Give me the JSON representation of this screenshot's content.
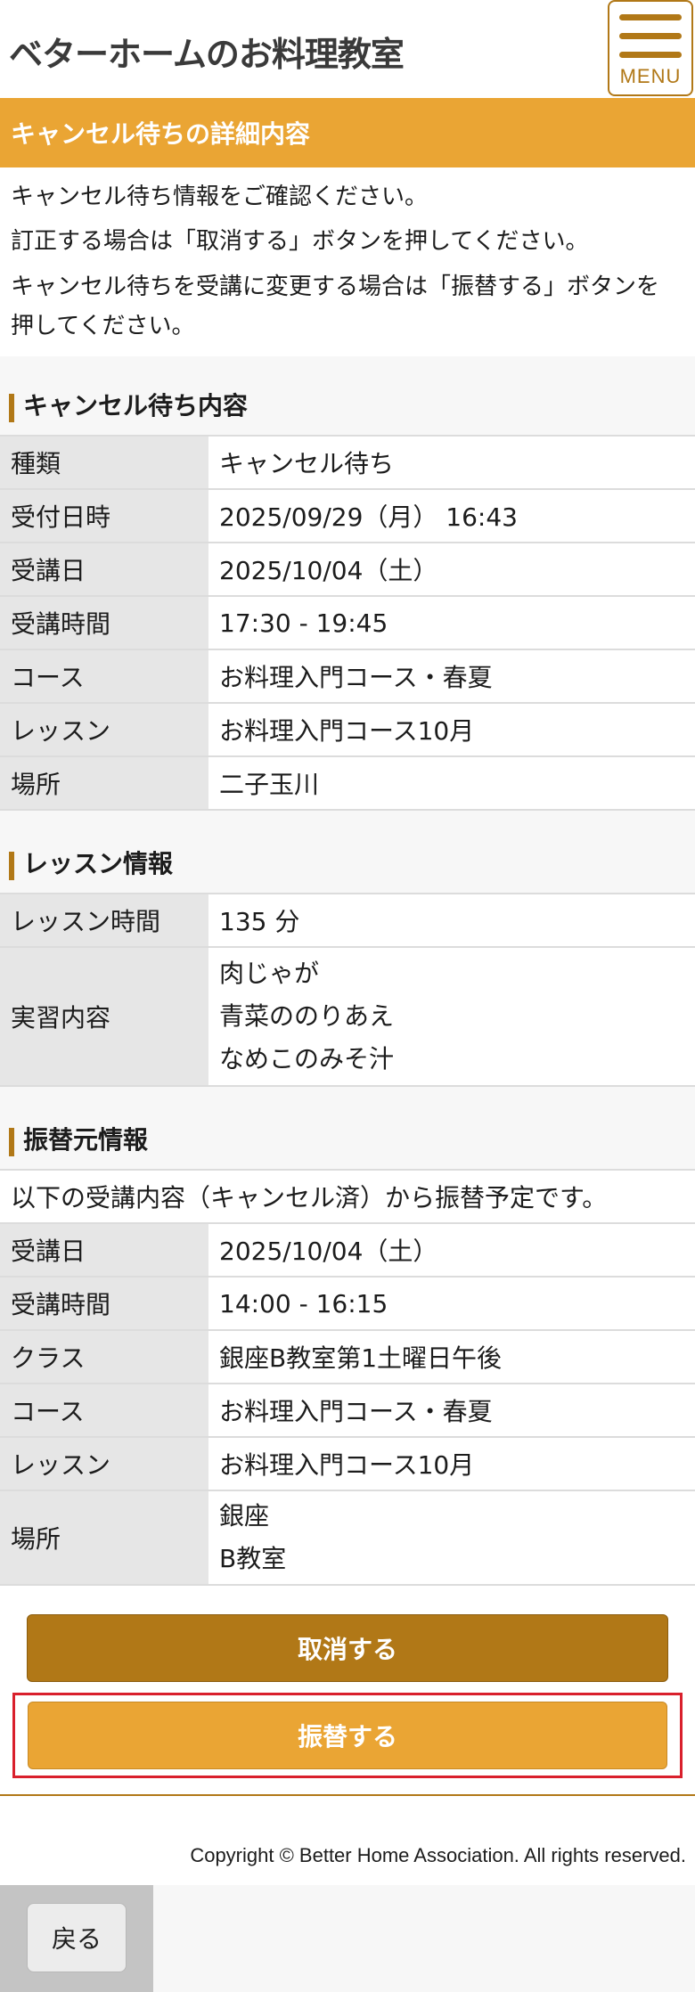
{
  "header": {
    "logo_text": "ベターホームのお料理教室",
    "menu_label": "MENU",
    "accent_color": "#b17817"
  },
  "title_bar": {
    "title": "キャンセル待ちの詳細内容",
    "color": "#eaa534"
  },
  "intro": {
    "line1": "キャンセル待ち情報をご確認ください。",
    "line2": "訂正する場合は「取消する」ボタンを押してください。",
    "line3a": "キャンセル待ちを受講に変更する場合は「振替する」ボタンを",
    "line3b": "押してください。"
  },
  "section_waitlist": {
    "heading": "キャンセル待ち内容",
    "rows": [
      {
        "label": "種類",
        "value": "キャンセル待ち"
      },
      {
        "label": "受付日時",
        "value": "2025/09/29（月） 16:43"
      },
      {
        "label": "受講日",
        "value": "2025/10/04（土）"
      },
      {
        "label": "受講時間",
        "value": "17:30 - 19:45"
      },
      {
        "label": "コース",
        "value": "お料理入門コース・春夏"
      },
      {
        "label": "レッスン",
        "value": "お料理入門コース10月"
      },
      {
        "label": "場所",
        "value": "二子玉川"
      }
    ]
  },
  "section_lesson": {
    "heading": "レッスン情報",
    "time_label": "レッスン時間",
    "time_value": "135 分",
    "content_label": "実習内容",
    "content_items": [
      "肉じゃが",
      "青菜ののりあえ",
      "なめこのみそ汁"
    ]
  },
  "section_source": {
    "heading": "振替元情報",
    "note": "以下の受講内容（キャンセル済）から振替予定です。",
    "rows": [
      {
        "label": "受講日",
        "value": "2025/10/04（土）"
      },
      {
        "label": "受講時間",
        "value": "14:00 - 16:15"
      },
      {
        "label": "クラス",
        "value": "銀座B教室第1土曜日午後"
      },
      {
        "label": "コース",
        "value": "お料理入門コース・春夏"
      },
      {
        "label": "レッスン",
        "value": "お料理入門コース10月"
      }
    ],
    "place_label": "場所",
    "place_lines": [
      "銀座",
      "B教室"
    ]
  },
  "buttons": {
    "cancel_label": "取消する",
    "transfer_label": "振替する",
    "back_label": "戻る"
  },
  "footer": {
    "copyright": "Copyright © Better Home Association. All rights reserved."
  }
}
